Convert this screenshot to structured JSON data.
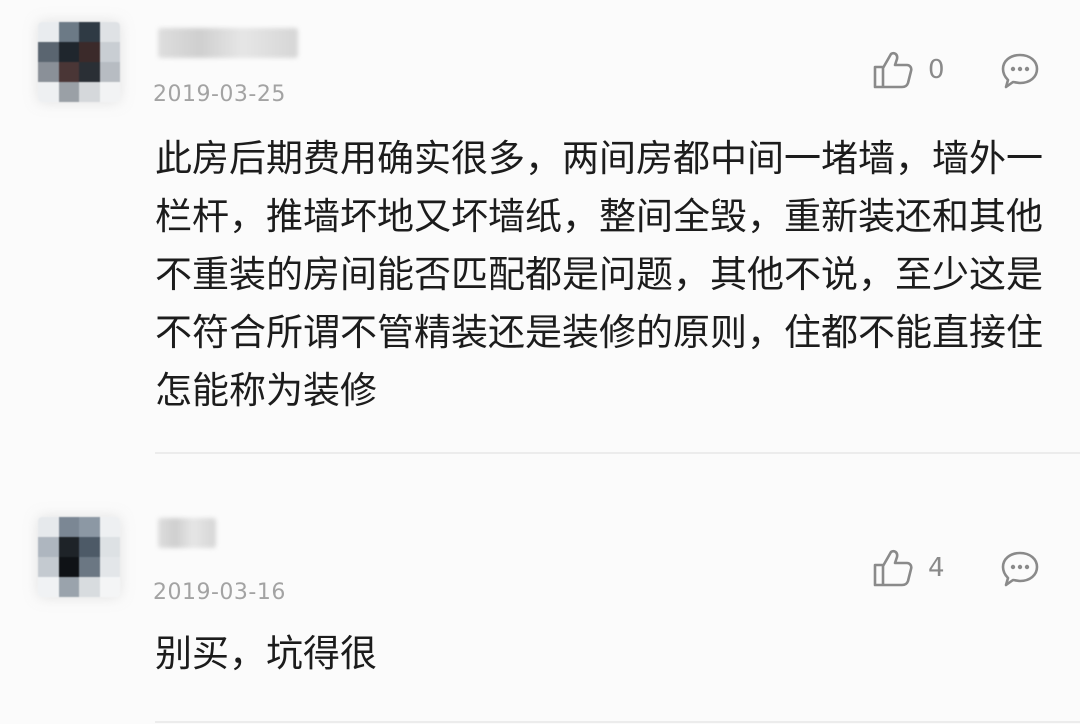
{
  "comments": [
    {
      "date": "2019-03-25",
      "likes": "0",
      "text": "此房后期费用确实很多，两间房都中间一堵墙，墙外一栏杆，推墙坏地又坏墙纸，整间全毁，重新装还和其他不重装的房间能否匹配都是问题，其他不说，至少这是不符合所谓不管精装还是装修的原则，住都不能直接住怎能称为装修"
    },
    {
      "date": "2019-03-16",
      "likes": "4",
      "text": "别买，坑得很"
    }
  ],
  "icons": {
    "like": "thumbs-up-icon",
    "reply": "comment-bubble-icon"
  },
  "colors": {
    "background": "#fbfbfb",
    "text": "#1c1c1c",
    "meta": "#a3a3a3",
    "icon": "#8a8a8a"
  }
}
